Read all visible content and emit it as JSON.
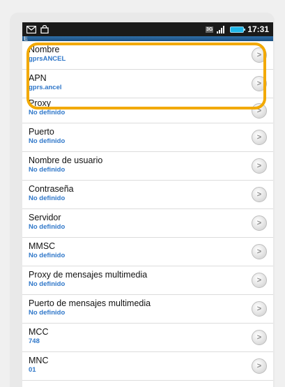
{
  "status_bar": {
    "network_badge": "3G",
    "time": "17:31",
    "icons": [
      "gmail-icon",
      "shopping-bag-icon",
      "3g-icon",
      "signal-icon",
      "battery-icon"
    ]
  },
  "title_bar": {
    "title": "E"
  },
  "settings": [
    {
      "label": "Nombre",
      "value": "gprsANCEL"
    },
    {
      "label": "APN",
      "value": "gprs.ancel"
    },
    {
      "label": "Proxy",
      "value": "No definido"
    },
    {
      "label": "Puerto",
      "value": "No definido"
    },
    {
      "label": "Nombre de usuario",
      "value": "No definido"
    },
    {
      "label": "Contraseña",
      "value": "No definido"
    },
    {
      "label": "Servidor",
      "value": "No definido"
    },
    {
      "label": "MMSC",
      "value": "No definido"
    },
    {
      "label": "Proxy de mensajes multimedia",
      "value": "No definido"
    },
    {
      "label": "Puerto de mensajes multimedia",
      "value": "No definido"
    },
    {
      "label": "MCC",
      "value": "748"
    },
    {
      "label": "MNC",
      "value": "01"
    }
  ],
  "colors": {
    "highlight": "#f2a900",
    "value_text": "#2f77c9",
    "status_bar": "#1a1a1a"
  }
}
